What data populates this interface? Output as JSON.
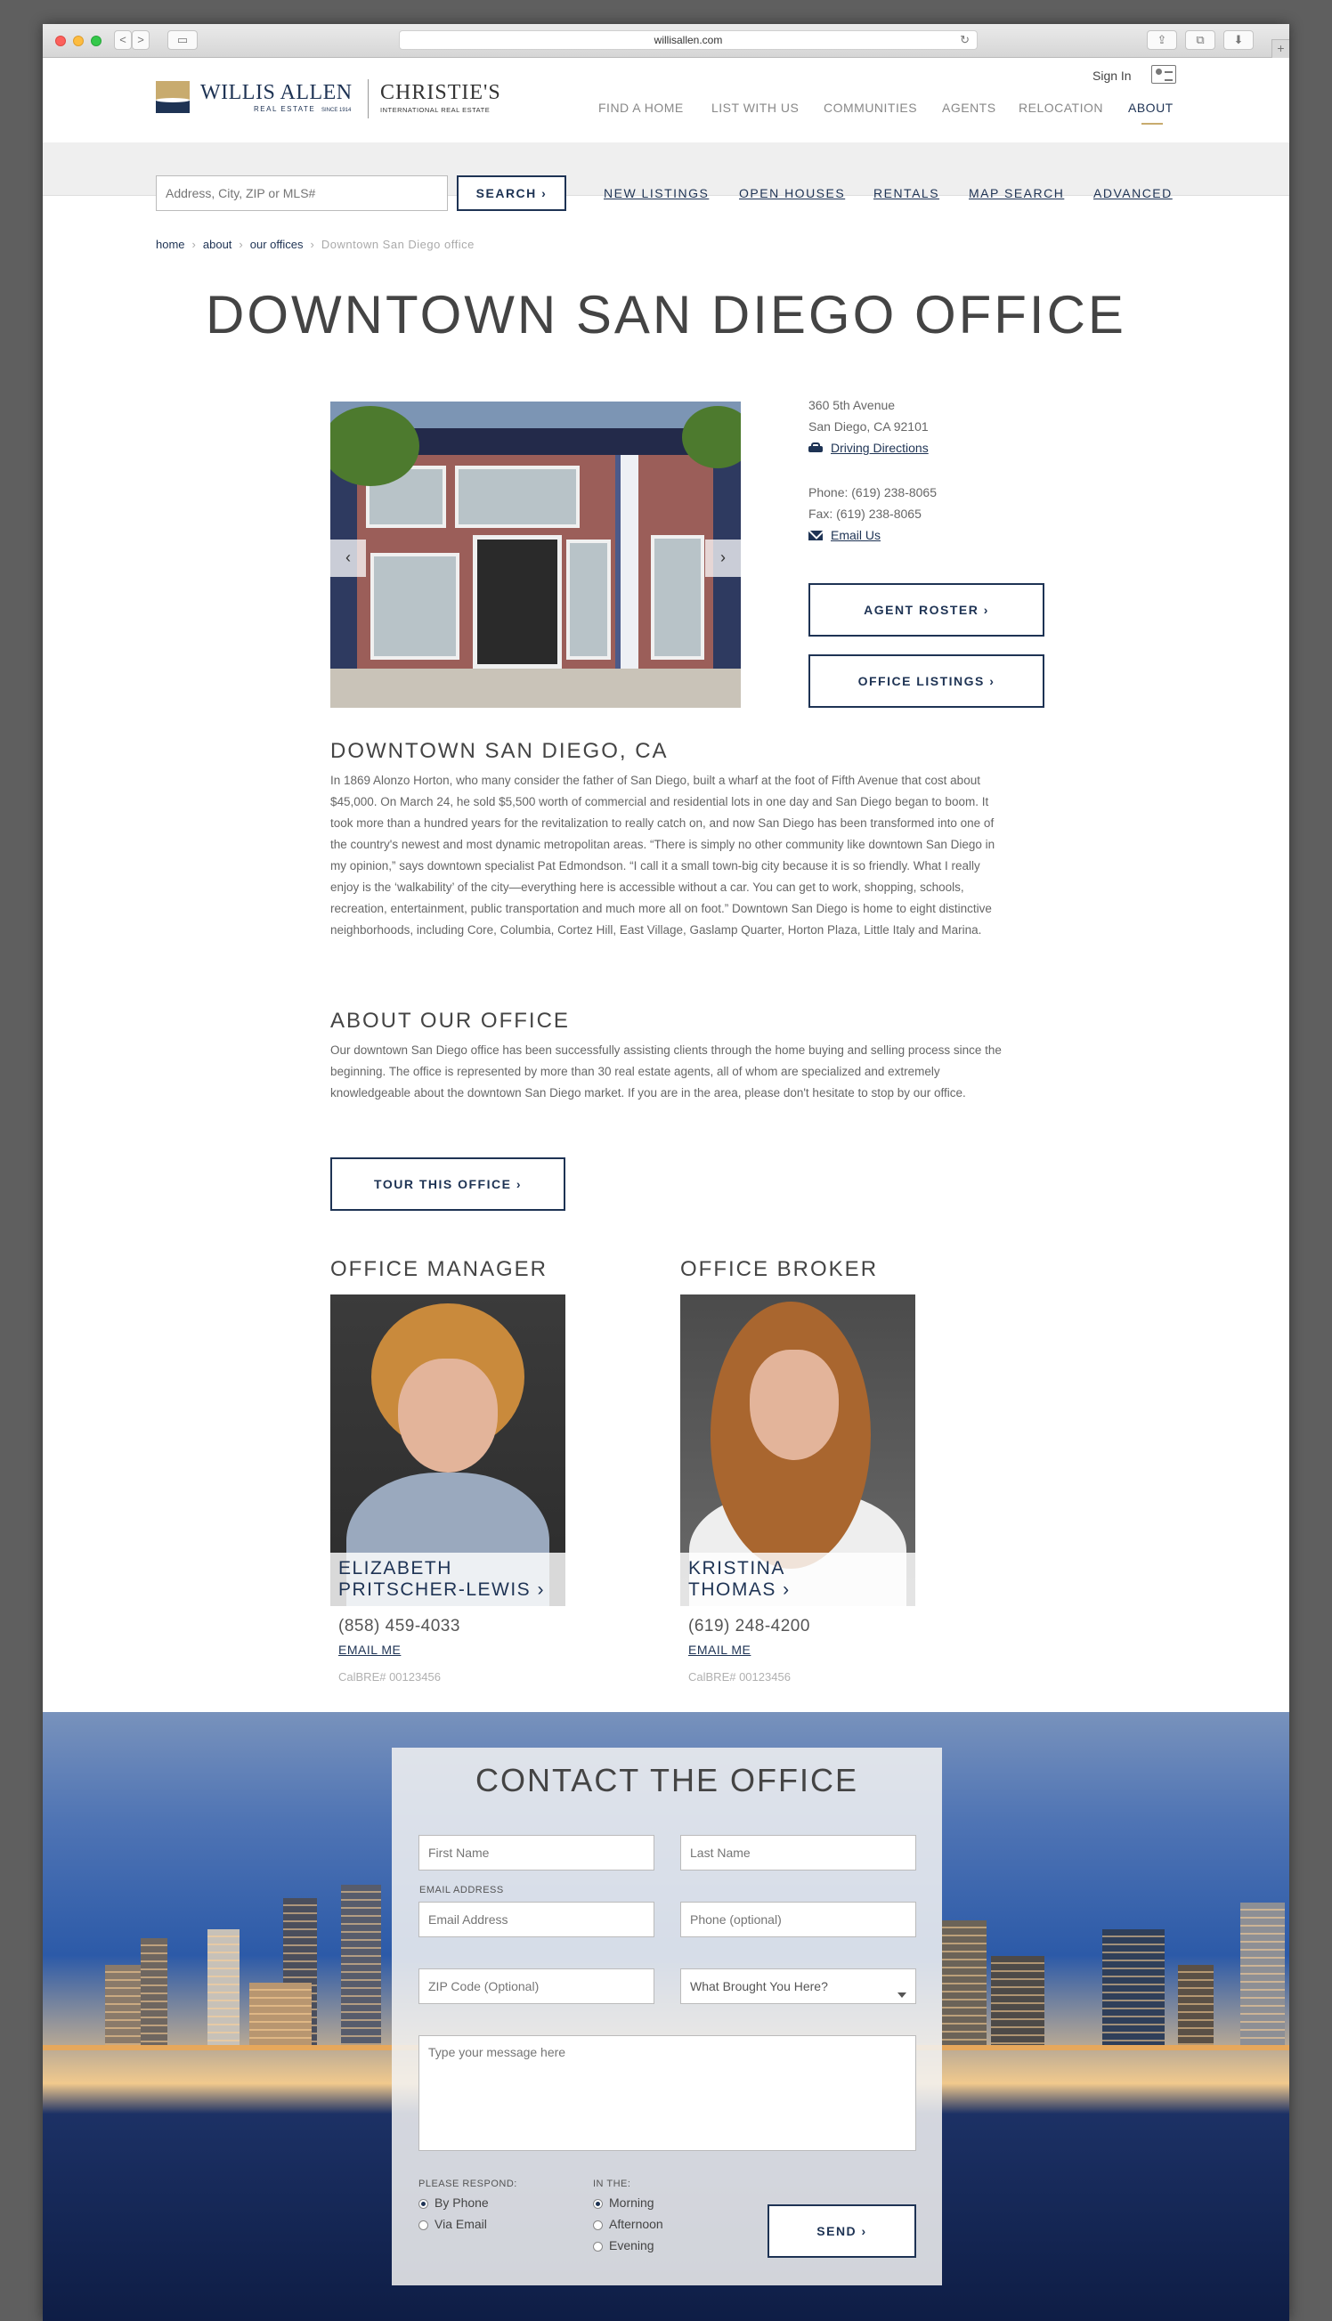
{
  "browser": {
    "url": "willisallen.com",
    "back": "<",
    "forward": ">",
    "reload": "↻",
    "new_tab": "+"
  },
  "header": {
    "logo": {
      "brand": "WILLIS ALLEN",
      "brand_sub": "REAL ESTATE",
      "since": "SINCE 1914",
      "partner": "CHRISTIE'S",
      "partner_sub": "INTERNATIONAL REAL ESTATE"
    },
    "sign_in": "Sign In",
    "nav": [
      "FIND A HOME",
      "LIST WITH US",
      "COMMUNITIES",
      "AGENTS",
      "RELOCATION",
      "ABOUT"
    ],
    "nav_active": "ABOUT"
  },
  "search": {
    "placeholder": "Address, City, ZIP or MLS#",
    "button": "SEARCH ›",
    "links": [
      "NEW LISTINGS",
      "OPEN HOUSES",
      "RENTALS",
      "MAP SEARCH",
      "ADVANCED"
    ]
  },
  "breadcrumb": [
    "home",
    "about",
    "our offices",
    "Downtown San Diego office"
  ],
  "page_title": "DOWNTOWN SAN DIEGO OFFICE",
  "office": {
    "address_line1": "360 5th Avenue",
    "address_line2": "San Diego, CA 92101",
    "directions_label": "Driving Directions",
    "phone": "Phone: (619) 238-8065",
    "fax": "Fax: (619) 238-8065",
    "email_label": "Email Us",
    "agent_roster_button": "AGENT ROSTER ›",
    "office_listings_button": "OFFICE LISTINGS ›",
    "photo_prev": "‹",
    "photo_next": "›"
  },
  "area": {
    "heading": "DOWNTOWN SAN DIEGO, CA",
    "body": "In 1869 Alonzo Horton, who many consider the father of San Diego, built a wharf at the foot of Fifth Avenue that cost about $45,000. On March 24, he sold $5,500 worth of commercial and residential lots in one day and San Diego began to boom. It took more than a hundred years for the revitalization to really catch on, and now San Diego has been transformed into one of the country's newest and most dynamic metropolitan areas. “There is simply no other community like downtown San Diego in my opinion,” says downtown specialist Pat Edmondson. “I call it a small town-big city because it is so friendly. What I really enjoy is the ‘walkability’ of the city—everything here is accessible without a car. You can get to work, shopping, schools, recreation, entertainment, public transportation and much more all on foot.” Downtown San Diego is home to eight distinctive neighborhoods, including Core, Columbia, Cortez Hill, East Village, Gaslamp Quarter, Horton Plaza, Little Italy and Marina."
  },
  "about": {
    "heading": "ABOUT OUR OFFICE",
    "body": "Our downtown San Diego office has been successfully assisting clients through the home buying and selling process since the beginning. The office is represented by more than 30 real estate agents, all of whom are specialized and extremely knowledgeable about the downtown San Diego market. If you are in the area, please don't hesitate to stop by our office.",
    "tour_button": "TOUR THIS OFFICE ›"
  },
  "manager": {
    "heading": "OFFICE MANAGER",
    "name_line1": "ELIZABETH",
    "name_line2": "PRITSCHER-LEWIS ›",
    "phone": "(858) 459-4033",
    "email_label": "EMAIL ME",
    "license": "CalBRE# 00123456"
  },
  "broker": {
    "heading": "OFFICE BROKER",
    "name_line1": "KRISTINA",
    "name_line2": "THOMAS ›",
    "phone": "(619) 248-4200",
    "email_label": "EMAIL ME",
    "license": "CalBRE# 00123456"
  },
  "contact": {
    "title": "CONTACT THE OFFICE",
    "first_name_placeholder": "First Name",
    "last_name_placeholder": "Last Name",
    "email_label": "EMAIL ADDRESS",
    "email_placeholder": "Email Address",
    "phone_placeholder": "Phone (optional)",
    "zip_placeholder": "ZIP Code (Optional)",
    "reason_value": "What Brought You Here?",
    "message_placeholder": "Type your message here",
    "respond_label": "PLEASE RESPOND:",
    "respond_options": [
      "By Phone",
      "Via Email"
    ],
    "respond_selected": "By Phone",
    "time_label": "IN THE:",
    "time_options": [
      "Morning",
      "Afternoon",
      "Evening"
    ],
    "time_selected": "Morning",
    "send_button": "SEND ›"
  },
  "colors": {
    "navy": "#1e3354",
    "gold": "#c8ab6e",
    "text_grey": "#666666",
    "search_bar_bg": "#efefef"
  },
  "icons": [
    "car-icon",
    "mail-icon",
    "profile-card-icon",
    "chevron-left-icon",
    "chevron-right-icon",
    "reload-icon"
  ]
}
